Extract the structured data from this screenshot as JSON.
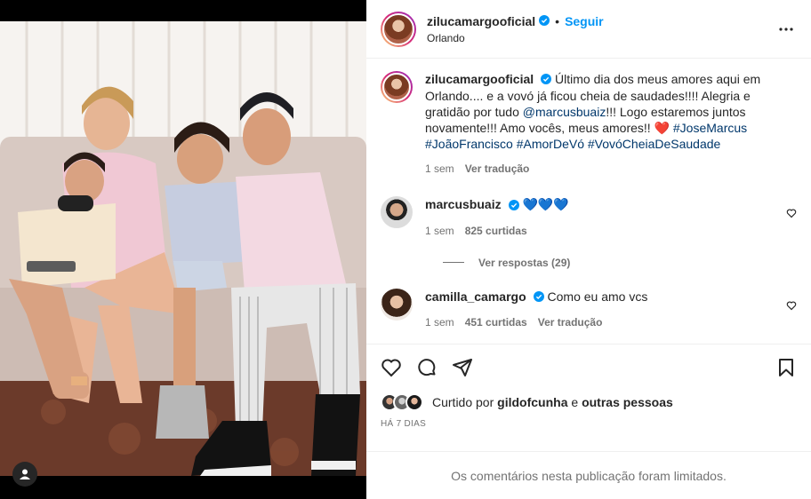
{
  "post": {
    "username": "zilucamargooficial",
    "follow_label": "Seguir",
    "separator": "•",
    "location": "Orlando"
  },
  "caption": {
    "username": "zilucamargooficial",
    "text": "Último dia dos meus amores aqui em Orlando.... e a vovó já ficou cheia de saudades!!!! Alegria e gratidão por tudo",
    "mention": "@marcusbuaiz",
    "text2": "!!! Logo estaremos juntos novamente!!! Amo vocês, meus amores!!",
    "heart": "❤️",
    "hashtags": [
      "#JoseMarcus",
      "#JoãoFrancisco",
      "#AmorDeVó",
      "#VovóCheiaDeSaudade"
    ],
    "time": "1 sem",
    "translate": "Ver tradução"
  },
  "comments": [
    {
      "username": "marcusbuaiz",
      "text": "💙💙💙",
      "time": "1 sem",
      "likes": "825 curtidas",
      "replies": "Ver respostas (29)"
    },
    {
      "username": "camilla_camargo",
      "text": "Como eu amo vcs",
      "time": "1 sem",
      "likes": "451 curtidas",
      "translate": "Ver tradução"
    }
  ],
  "likes": {
    "prefix": "Curtido por",
    "user": "gildofcunha",
    "mid": "e",
    "others": "outras pessoas"
  },
  "posted": "HÁ 7 DIAS",
  "comments_limited": "Os comentários nesta publicação foram limitados.",
  "colors": {
    "link": "#0095f6",
    "hashtag": "#00376b",
    "muted": "#737373",
    "verified": "#0095f6"
  }
}
